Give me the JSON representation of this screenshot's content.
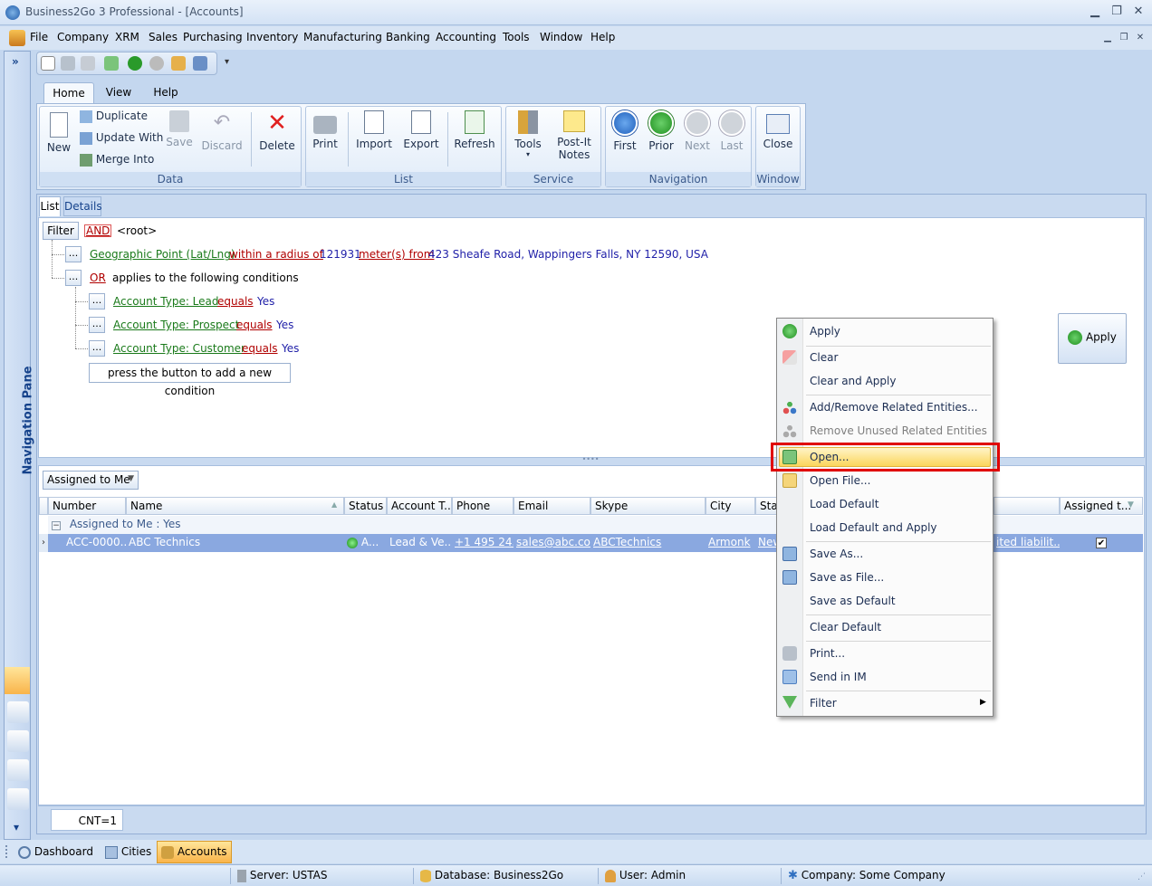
{
  "window": {
    "title": "Business2Go 3 Professional - [Accounts]"
  },
  "menu": [
    "File",
    "Company",
    "XRM",
    "Sales",
    "Purchasing",
    "Inventory",
    "Manufacturing",
    "Banking",
    "Accounting",
    "Tools",
    "Window",
    "Help"
  ],
  "ribbon_tabs": [
    "Home",
    "View",
    "Help"
  ],
  "ribbon": {
    "data": {
      "label": "Data",
      "new": "New",
      "duplicate": "Duplicate",
      "update_with": "Update With",
      "merge_into": "Merge Into",
      "save": "Save",
      "discard": "Discard",
      "delete": "Delete"
    },
    "list": {
      "label": "List",
      "print": "Print",
      "import": "Import",
      "export": "Export",
      "refresh": "Refresh"
    },
    "service": {
      "label": "Service",
      "tools": "Tools",
      "postit_l1": "Post-It",
      "postit_l2": "Notes"
    },
    "navigation": {
      "label": "Navigation",
      "first": "First",
      "prior": "Prior",
      "next": "Next",
      "last": "Last"
    },
    "window": {
      "label": "Window",
      "close": "Close"
    }
  },
  "nav_pane": {
    "label": "Navigation Pane",
    "expand": "»"
  },
  "view_tabs": [
    "List",
    "Details"
  ],
  "filter": {
    "filter_btn": "Filter",
    "and": "AND",
    "root": "<root>",
    "geo": {
      "field": "Geographic Point (Lat/Lng)",
      "op": "within a radius of",
      "value": "121931",
      "unit": "meter(s) from",
      "address": "423 Sheafe Road, Wappingers Falls, NY 12590, USA"
    },
    "or": "OR",
    "or_text": "applies to the following conditions",
    "conditions": [
      {
        "field": "Account Type: Lead",
        "op": "equals",
        "value": "Yes"
      },
      {
        "field": "Account Type: Prospect",
        "op": "equals",
        "value": "Yes"
      },
      {
        "field": "Account Type: Customer",
        "op": "equals",
        "value": "Yes"
      }
    ],
    "add_condition": "press the button to add a new condition",
    "dots": "...",
    "apply": "Apply"
  },
  "grid": {
    "view_selector": "Assigned to Me",
    "columns": [
      "Number",
      "Name",
      "Status",
      "Account T...",
      "Phone",
      "Email",
      "Skype",
      "City",
      "Stat",
      "Assigned t..."
    ],
    "group_row": "Assigned to Me : Yes",
    "row": {
      "number": "ACC-0000...",
      "name": "ABC Technics",
      "status": "A...",
      "account_type": "Lead & Ve...",
      "phone": "+1 495 24...",
      "email": "sales@abc.co...",
      "skype": "ABCTechnics",
      "city": "Armonk",
      "state": "New",
      "legal": "ited liabilit...",
      "assigned": "✔"
    },
    "count": "CNT=1"
  },
  "context_menu": [
    {
      "label": "Apply",
      "icon": "apply-icon"
    },
    {
      "label": "Clear",
      "icon": "eraser-icon"
    },
    {
      "label": "Clear and Apply",
      "icon": ""
    },
    {
      "label": "Add/Remove Related Entities...",
      "icon": "related-icon"
    },
    {
      "label": "Remove Unused Related Entities",
      "icon": "related-icon",
      "disabled": true
    },
    {
      "label": "Open...",
      "icon": "open-icon"
    },
    {
      "label": "Open File...",
      "icon": "open-file-icon"
    },
    {
      "label": "Load Default",
      "icon": ""
    },
    {
      "label": "Load Default and Apply",
      "icon": ""
    },
    {
      "label": "Save As...",
      "icon": "save-as-icon"
    },
    {
      "label": "Save as File...",
      "icon": "save-file-icon"
    },
    {
      "label": "Save as Default",
      "icon": ""
    },
    {
      "label": "Clear Default",
      "icon": ""
    },
    {
      "label": "Print...",
      "icon": "print-icon"
    },
    {
      "label": "Send in IM",
      "icon": "send-im-icon"
    },
    {
      "label": "Filter",
      "icon": "filter-icon"
    }
  ],
  "bottom_tabs": [
    "Dashboard",
    "Cities",
    "Accounts"
  ],
  "status": {
    "server": "Server: USTAS",
    "database": "Database: Business2Go",
    "user": "User: Admin",
    "company": "Company: Some Company"
  },
  "colors": {
    "highlight_border": "#e00000",
    "menu_hover": "#fbe38a",
    "selected_row": "#8aa8e0"
  }
}
